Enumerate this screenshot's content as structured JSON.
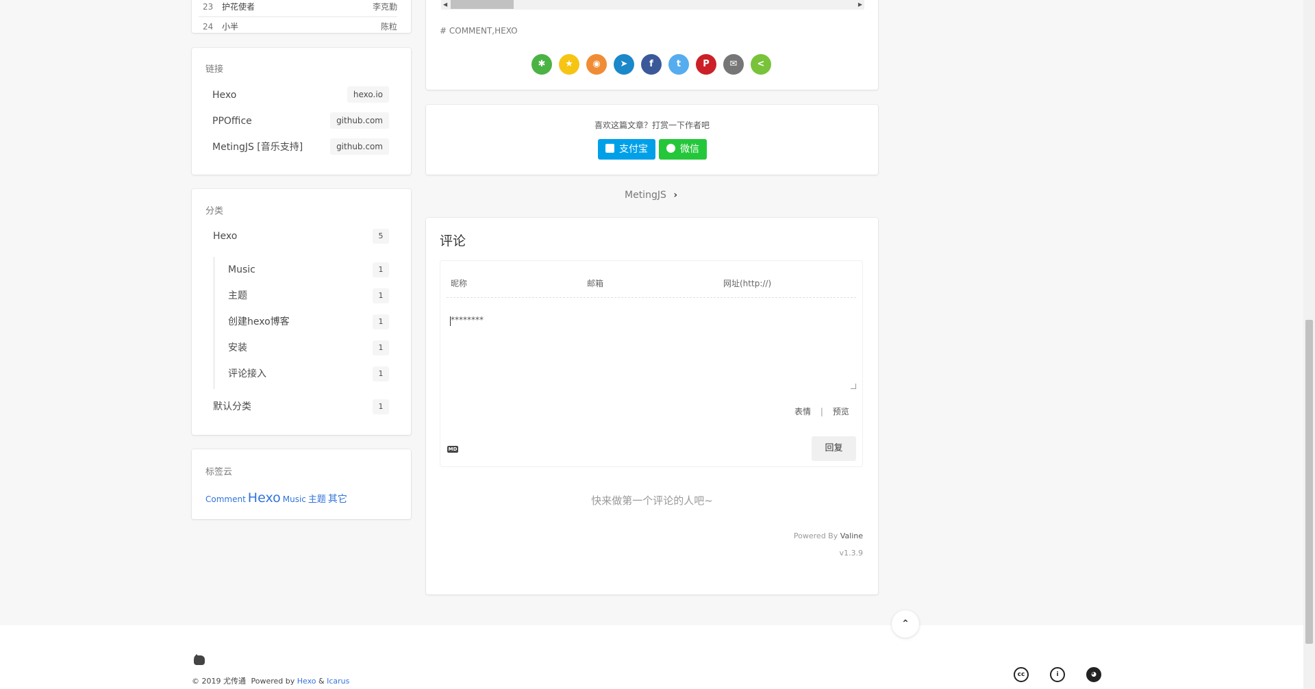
{
  "sidebar": {
    "music_rank": [
      {
        "num": "23",
        "song": "护花使者",
        "artist": "李克勤"
      },
      {
        "num": "24",
        "song": "小半",
        "artist": "陈粒"
      }
    ],
    "links": {
      "label": "链接",
      "items": [
        {
          "name": "Hexo",
          "domain": "hexo.io"
        },
        {
          "name": "PPOffice",
          "domain": "github.com"
        },
        {
          "name": "MetingJS [音乐支持]",
          "domain": "github.com"
        }
      ]
    },
    "categories": {
      "label": "分类",
      "top": {
        "name": "Hexo",
        "count": "5"
      },
      "children": [
        {
          "name": "Music",
          "count": "1"
        },
        {
          "name": "主题",
          "count": "1"
        },
        {
          "name": "创建hexo博客",
          "count": "1"
        },
        {
          "name": "安装",
          "count": "1"
        },
        {
          "name": "评论接入",
          "count": "1"
        }
      ],
      "default": {
        "name": "默认分类",
        "count": "1"
      }
    },
    "tagcloud": {
      "label": "标签云",
      "tags": [
        "Comment",
        "Hexo",
        "Music",
        "主题",
        "其它"
      ]
    }
  },
  "article": {
    "tags": "# COMMENT,HEXO",
    "share_buttons": [
      {
        "icon": "wechat-icon",
        "color": "#4bb344",
        "glyph": "✱"
      },
      {
        "icon": "qzone-icon",
        "color": "#f6c514",
        "glyph": "★"
      },
      {
        "icon": "weibo-icon",
        "color": "#f08c34",
        "glyph": "◉"
      },
      {
        "icon": "telegram-icon",
        "color": "#1a88c9",
        "glyph": "➤"
      },
      {
        "icon": "facebook-icon",
        "color": "#3b5999",
        "glyph": "f"
      },
      {
        "icon": "twitter-icon",
        "color": "#55acee",
        "glyph": "t"
      },
      {
        "icon": "pinterest-icon",
        "color": "#cb2027",
        "glyph": "P"
      },
      {
        "icon": "email-icon",
        "color": "#767676",
        "glyph": "✉"
      },
      {
        "icon": "sharethis-icon",
        "color": "#78c33a",
        "glyph": "<"
      }
    ]
  },
  "donate": {
    "text": "喜欢这篇文章？打赏一下作者吧",
    "alipay": "支付宝",
    "wechat": "微信",
    "alipay_color": "#00a0e9",
    "wechat_color": "#25c73a"
  },
  "next_post": {
    "label": "MetingJS"
  },
  "comments": {
    "title": "评论",
    "nick_placeholder": "昵称",
    "mail_placeholder": "邮箱",
    "link_placeholder": "网址(http://)",
    "textarea_value": "********",
    "emoji": "表情",
    "sep": "|",
    "preview": "预览",
    "markdown_badge": "MD",
    "submit": "回复",
    "empty": "快来做第一个评论的人吧~",
    "powered_prefix": "Powered By",
    "powered_name": "Valine",
    "version": "v1.3.9"
  },
  "footer": {
    "copyright": "© 2019 尤传通",
    "powered_by": "Powered by",
    "hexo": "Hexo",
    "amp": "&",
    "icarus": "Icarus",
    "icons": [
      "creative-commons-icon",
      "attribution-icon",
      "github-icon"
    ]
  }
}
